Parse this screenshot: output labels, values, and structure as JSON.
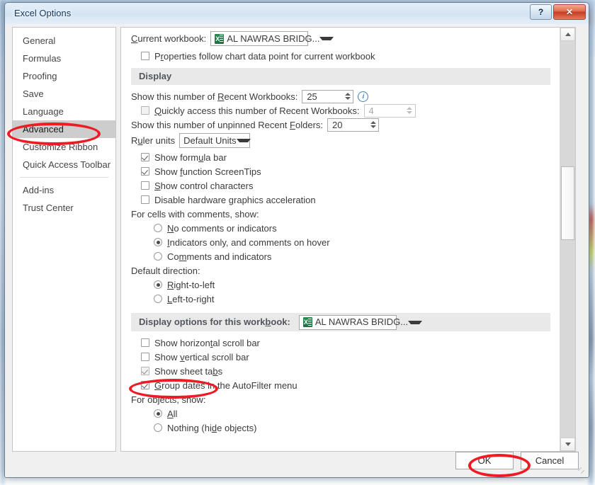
{
  "window": {
    "title": "Excel Options",
    "help_button": "?",
    "close_button": "✕"
  },
  "sidebar": {
    "items": [
      {
        "label": "General",
        "selected": false
      },
      {
        "label": "Formulas",
        "selected": false
      },
      {
        "label": "Proofing",
        "selected": false
      },
      {
        "label": "Save",
        "selected": false
      },
      {
        "label": "Language",
        "selected": false
      },
      {
        "label": "Advanced",
        "selected": true
      },
      {
        "label": "Customize Ribbon",
        "selected": false
      },
      {
        "label": "Quick Access Toolbar",
        "selected": false
      },
      {
        "label": "Add-ins",
        "selected": false
      },
      {
        "label": "Trust Center",
        "selected": false
      }
    ]
  },
  "content": {
    "current_workbook": {
      "label": "Current workbook:",
      "value": "AL NAWRAS BRIDG...",
      "icon": "excel-file-icon"
    },
    "properties_follow": {
      "label": "Properties follow chart data point for current workbook",
      "checked": false
    },
    "display_section": {
      "header": "Display",
      "recent_workbooks": {
        "label": "Show this number of Recent Workbooks:",
        "value": "25",
        "info_icon": "info-icon"
      },
      "quick_access_recent": {
        "label": "Quickly access this number of Recent Workbooks:",
        "value": "4",
        "checked": false,
        "disabled": true
      },
      "unpinned_folders": {
        "label": "Show this number of unpinned Recent Folders:",
        "value": "20"
      },
      "ruler_units": {
        "label": "Ruler units",
        "value": "Default Units"
      },
      "checkboxes": [
        {
          "label": "Show formula bar",
          "checked": true
        },
        {
          "label": "Show function ScreenTips",
          "checked": true
        },
        {
          "label": "Show control characters",
          "checked": false
        },
        {
          "label": "Disable hardware graphics acceleration",
          "checked": false
        }
      ],
      "comments_group": {
        "label": "For cells with comments, show:",
        "options": [
          {
            "label": "No comments or indicators",
            "selected": false
          },
          {
            "label": "Indicators only, and comments on hover",
            "selected": true
          },
          {
            "label": "Comments and indicators",
            "selected": false
          }
        ]
      },
      "direction_group": {
        "label": "Default direction:",
        "options": [
          {
            "label": "Right-to-left",
            "selected": true
          },
          {
            "label": "Left-to-right",
            "selected": false
          }
        ]
      }
    },
    "workbook_section": {
      "header": "Display options for this workbook:",
      "workbook_value": "AL NAWRAS BRIDG...",
      "icon": "excel-file-icon",
      "checkboxes": [
        {
          "label": "Show horizontal scroll bar",
          "checked": false,
          "highlighted": false
        },
        {
          "label": "Show vertical scroll bar",
          "checked": false,
          "highlighted": false
        },
        {
          "label": "Show sheet tabs",
          "checked": true,
          "highlighted": true
        },
        {
          "label": "Group dates in the AutoFilter menu",
          "checked": true,
          "highlighted": false
        }
      ],
      "objects_group": {
        "label": "For objects, show:",
        "options": [
          {
            "label": "All",
            "selected": true
          },
          {
            "label": "Nothing (hide objects)",
            "selected": false
          }
        ]
      }
    }
  },
  "footer": {
    "ok_label": "OK",
    "cancel_label": "Cancel"
  },
  "annotations": {
    "color": "#ed1c24",
    "targets": [
      "sidebar-item-advanced",
      "show-sheet-tabs-checkbox",
      "ok-button"
    ]
  }
}
